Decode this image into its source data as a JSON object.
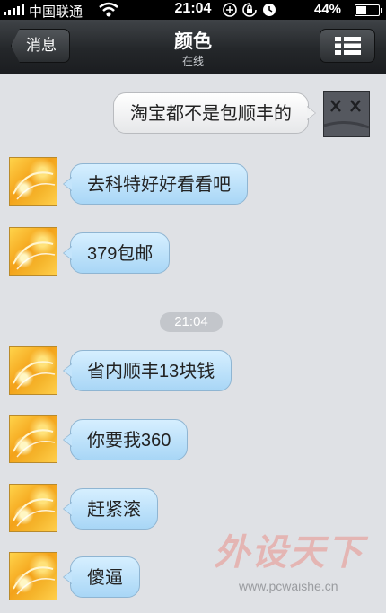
{
  "status_bar": {
    "carrier": "中国联通",
    "time": "21:04",
    "battery": "44%",
    "battery_level": 0.44
  },
  "nav": {
    "back_label": "消息",
    "title": "颜色",
    "subtitle": "在线"
  },
  "messages": [
    {
      "side": "outgoing",
      "text": "淘宝都不是包顺丰的"
    },
    {
      "side": "incoming",
      "text": "去科特好好看看吧"
    },
    {
      "side": "incoming",
      "text": "379包邮"
    },
    {
      "side": "incoming",
      "text": "省内顺丰13块钱"
    },
    {
      "side": "incoming",
      "text": "你要我360"
    },
    {
      "side": "incoming",
      "text": "赶紧滚"
    },
    {
      "side": "incoming",
      "text": "傻逼"
    }
  ],
  "timestamp": "21:04",
  "watermark": {
    "title": "外设天下",
    "url": "www.pcwaishe.cn"
  },
  "icons": {
    "wifi": "wifi-icon",
    "menu": "list-menu-icon",
    "lock": "rotation-lock-icon",
    "alarm": "alarm-icon",
    "location": "location-icon",
    "battery": "battery-icon"
  }
}
